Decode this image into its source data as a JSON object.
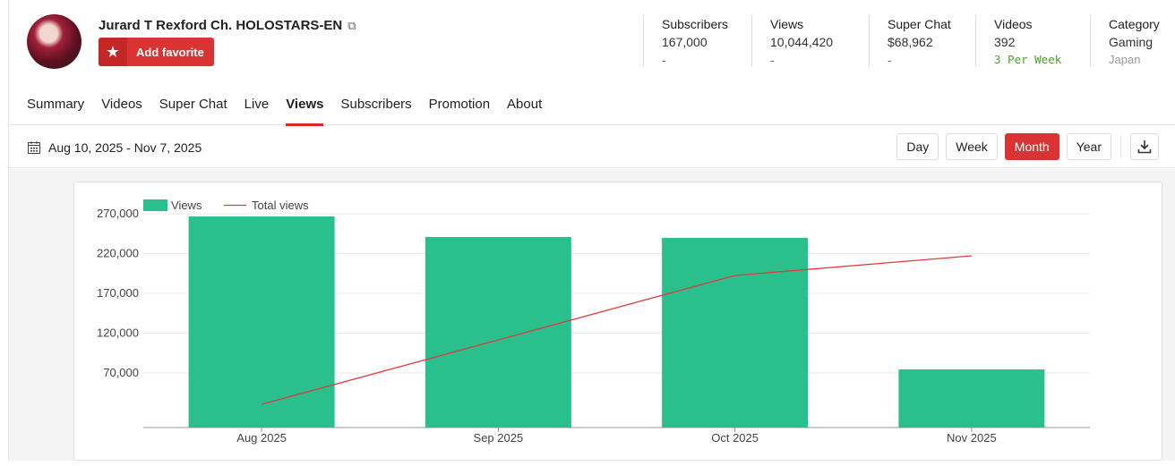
{
  "channel": {
    "name": "Jurard T Rexford Ch. HOLOSTARS-EN",
    "favorite_label": "Add favorite"
  },
  "stats": [
    {
      "label": "Subscribers",
      "value": "167,000",
      "sub": "-"
    },
    {
      "label": "Views",
      "value": "10,044,420",
      "sub": "-"
    },
    {
      "label": "Super Chat",
      "value": "$68,962",
      "sub": "-"
    },
    {
      "label": "Videos",
      "value": "392",
      "sub": "3 Per Week"
    },
    {
      "label": "Category",
      "value": "Gaming",
      "sub": "Japan"
    }
  ],
  "tabs": [
    "Summary",
    "Videos",
    "Super Chat",
    "Live",
    "Views",
    "Subscribers",
    "Promotion",
    "About"
  ],
  "active_tab": "Views",
  "date_range": "Aug 10, 2025 - Nov 7, 2025",
  "periods": [
    "Day",
    "Week",
    "Month",
    "Year"
  ],
  "active_period": "Month",
  "colors": {
    "accent": "#d93333",
    "bar": "#29c08e",
    "line": "#e03c3c"
  },
  "chart_data": {
    "type": "bar",
    "categories": [
      "Aug 2025",
      "Sep 2025",
      "Oct 2025",
      "Nov 2025"
    ],
    "series": [
      {
        "name": "Views",
        "type": "bar",
        "values": [
          266600,
          240800,
          239700,
          74500
        ]
      },
      {
        "name": "Total views",
        "type": "line",
        "values": [
          30700,
          111600,
          192500,
          217200
        ]
      }
    ],
    "yticks": [
      "270,000",
      "220,000",
      "170,000",
      "120,000",
      "70,000"
    ],
    "ytick_values": [
      270000,
      220000,
      170000,
      120000,
      70000
    ],
    "ylim": [
      1500,
      270000
    ],
    "legend": "top-left",
    "grid": true
  }
}
